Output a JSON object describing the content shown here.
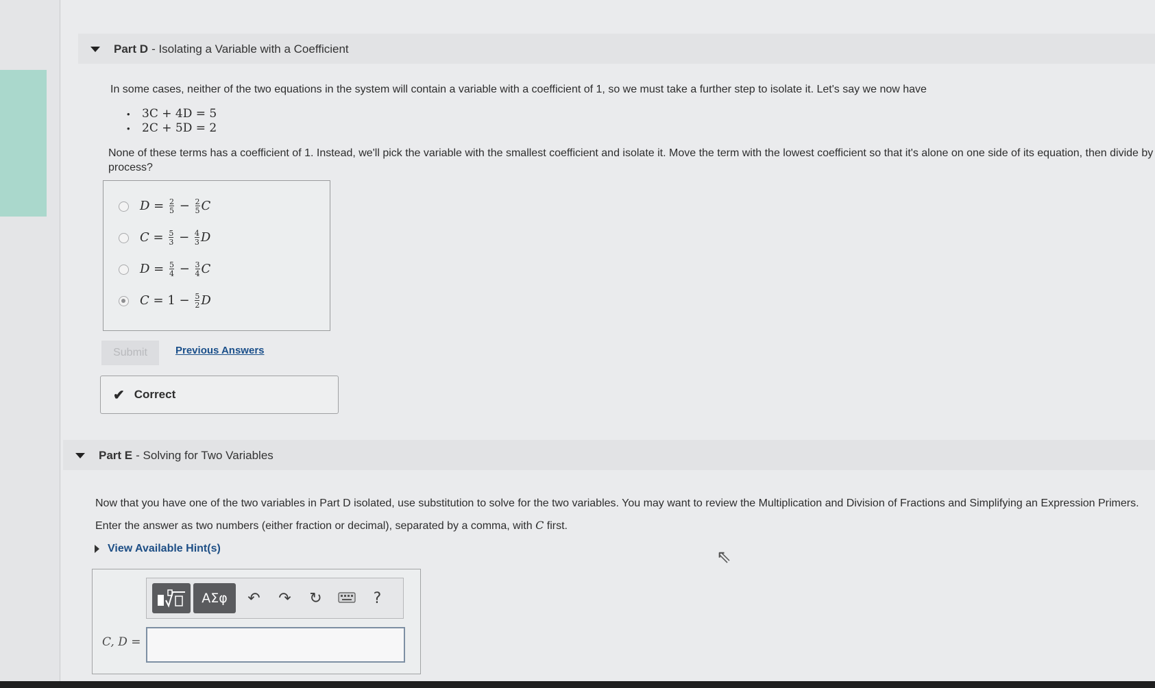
{
  "partD": {
    "header_bold": "Part D",
    "header_rest": "- Isolating a Variable with a Coefficient",
    "intro": "In some cases, neither of the two equations in the system will contain a variable with a coefficient of 1, so we must take a further step to isolate it. Let's say we now have",
    "equations": [
      "3C + 4D = 5",
      "2C + 5D = 2"
    ],
    "question_line1": "None of these terms has a coefficient of 1. Instead, we'll pick the variable with the smallest coefficient and isolate it. Move the term with the lowest coefficient so that it's alone on one side of its equation, then divide by the",
    "question_line2": "process?",
    "choices": [
      {
        "lhs": "D",
        "a_num": "2",
        "a_den": "5",
        "b_num": "2",
        "b_den": "5",
        "var": "C",
        "selected": false
      },
      {
        "lhs": "C",
        "a_num": "5",
        "a_den": "3",
        "b_num": "4",
        "b_den": "3",
        "var": "D",
        "selected": false
      },
      {
        "lhs": "D",
        "a_num": "5",
        "a_den": "4",
        "b_num": "3",
        "b_den": "4",
        "var": "C",
        "selected": false
      },
      {
        "lhs": "C",
        "a_whole": "1",
        "b_num": "5",
        "b_den": "2",
        "var": "D",
        "selected": true
      }
    ],
    "submit_label": "Submit",
    "previous_answers_label": "Previous Answers",
    "feedback": "Correct"
  },
  "partE": {
    "header_bold": "Part E",
    "header_rest": "- Solving for Two Variables",
    "para1": "Now that you have one of the two variables in Part D isolated, use substitution to solve for the two variables. You may want to review the Multiplication and Division of Fractions and Simplifying an Expression Primers.",
    "para2_pre": "Enter the answer as two numbers (either fraction or decimal), separated by a comma, with",
    "para2_var": "C",
    "para2_post": "first.",
    "hint_label": "View Available Hint(s)",
    "toolbar": {
      "templates_icon": "math-templates-icon",
      "symbols_label": "ΑΣφ",
      "undo_icon": "undo-icon",
      "redo_icon": "redo-icon",
      "reset_icon": "reset-icon",
      "keyboard_icon": "keyboard-icon",
      "help_label": "?"
    },
    "input_label": "C, D =",
    "input_value": ""
  }
}
